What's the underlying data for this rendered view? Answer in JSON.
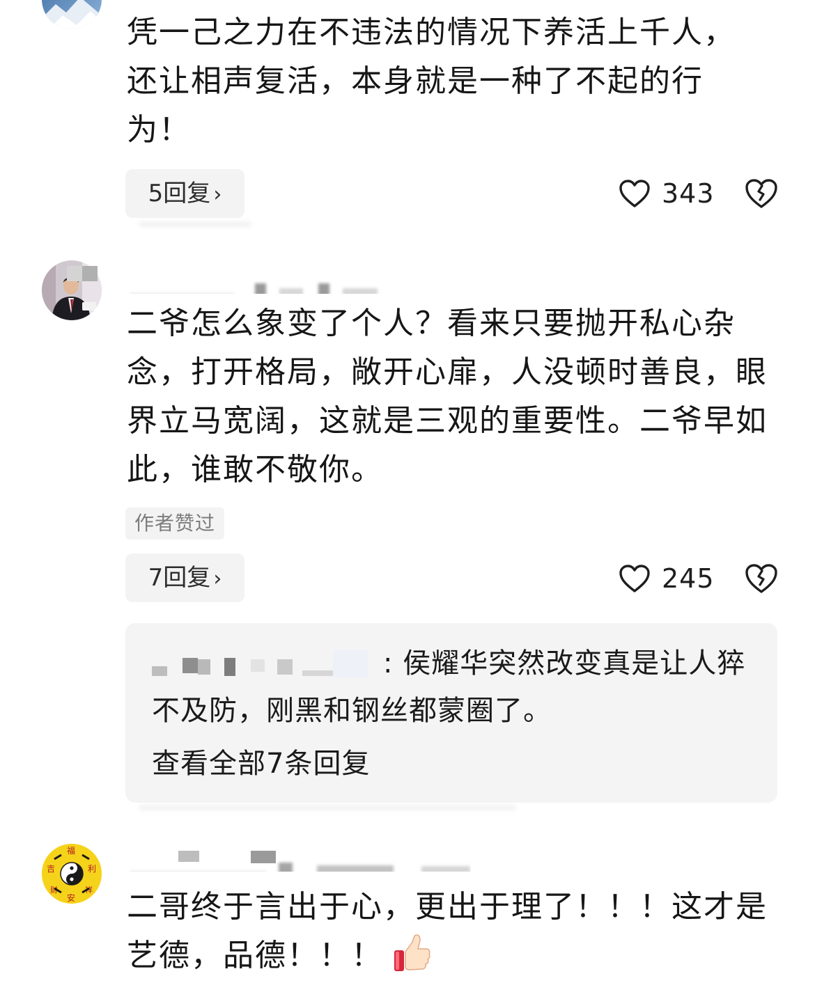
{
  "comments": [
    {
      "text": "凭一己之力在不违法的情况下养活上千人，还让相声复活，本身就是一种了不起的行为！",
      "reply_button": "5回复",
      "chevron": "›",
      "likes": "343"
    },
    {
      "text": "二爷怎么象变了个人？看来只要抛开私心杂念，打开格局，敞开心扉，人没顿时善良，眼界立马宽阔，这就是三观的重要性。二爷早如此，谁敢不敬你。",
      "author_liked": "作者赞过",
      "reply_button": "7回复",
      "chevron": "›",
      "likes": "245",
      "reply_preview": {
        "text": ": 侯耀华突然改变真是让人猝不及防，刚黑和钢丝都蒙圈了。",
        "view_all": "查看全部7条回复"
      }
    },
    {
      "text": "二哥终于言出于心，更出于理了！！！这才是艺德，品德！！！"
    }
  ],
  "icons": {
    "like": "heart-outline-icon",
    "dislike": "broken-heart-icon",
    "reaction": "thumbs-up-emoji"
  },
  "colors": {
    "text": "#161616",
    "muted": "#b8b8b8",
    "chip_bg": "#f3f3f4"
  }
}
